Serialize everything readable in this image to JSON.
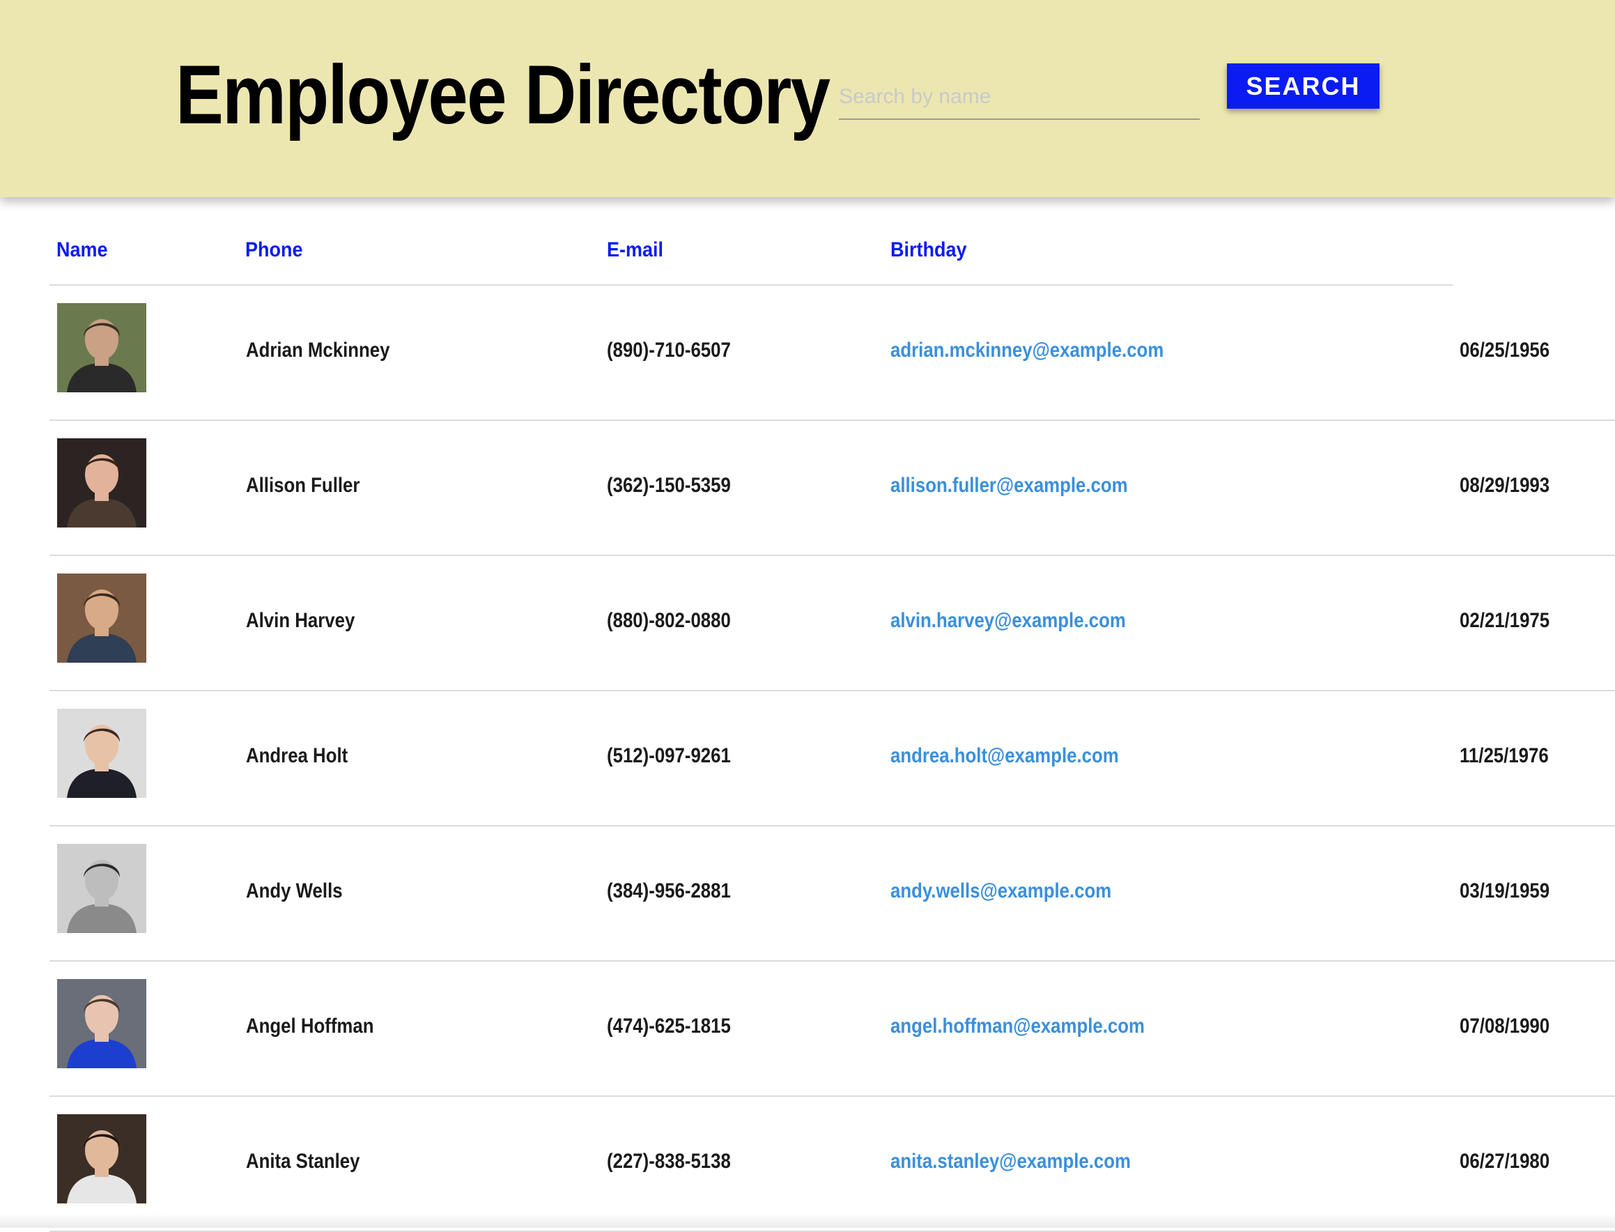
{
  "header": {
    "title": "Employee Directory",
    "search_placeholder": "Search by name",
    "search_value": "",
    "search_button_label": "SEARCH",
    "background_color": "#ece7b1",
    "button_color": "#0a1cf2"
  },
  "table": {
    "columns": [
      "Name",
      "Phone",
      "E-mail",
      "Birthday"
    ],
    "header_color": "#0a1cf2",
    "email_color": "#3a8fdc",
    "rows": [
      {
        "name": "Adrian Mckinney",
        "phone": "(890)-710-6507",
        "email": "adrian.mckinney@example.com",
        "birthday": "06/25/1956",
        "avatar": "man-photo"
      },
      {
        "name": "Allison Fuller",
        "phone": "(362)-150-5359",
        "email": "allison.fuller@example.com",
        "birthday": "08/29/1993",
        "avatar": "woman-photo"
      },
      {
        "name": "Alvin Harvey",
        "phone": "(880)-802-0880",
        "email": "alvin.harvey@example.com",
        "birthday": "02/21/1975",
        "avatar": "man-photo"
      },
      {
        "name": "Andrea Holt",
        "phone": "(512)-097-9261",
        "email": "andrea.holt@example.com",
        "birthday": "11/25/1976",
        "avatar": "woman-photo"
      },
      {
        "name": "Andy Wells",
        "phone": "(384)-956-2881",
        "email": "andy.wells@example.com",
        "birthday": "03/19/1959",
        "avatar": "man-photo"
      },
      {
        "name": "Angel Hoffman",
        "phone": "(474)-625-1815",
        "email": "angel.hoffman@example.com",
        "birthday": "07/08/1990",
        "avatar": "man-photo"
      },
      {
        "name": "Anita Stanley",
        "phone": "(227)-838-5138",
        "email": "anita.stanley@example.com",
        "birthday": "06/27/1980",
        "avatar": "woman-photo"
      }
    ]
  }
}
